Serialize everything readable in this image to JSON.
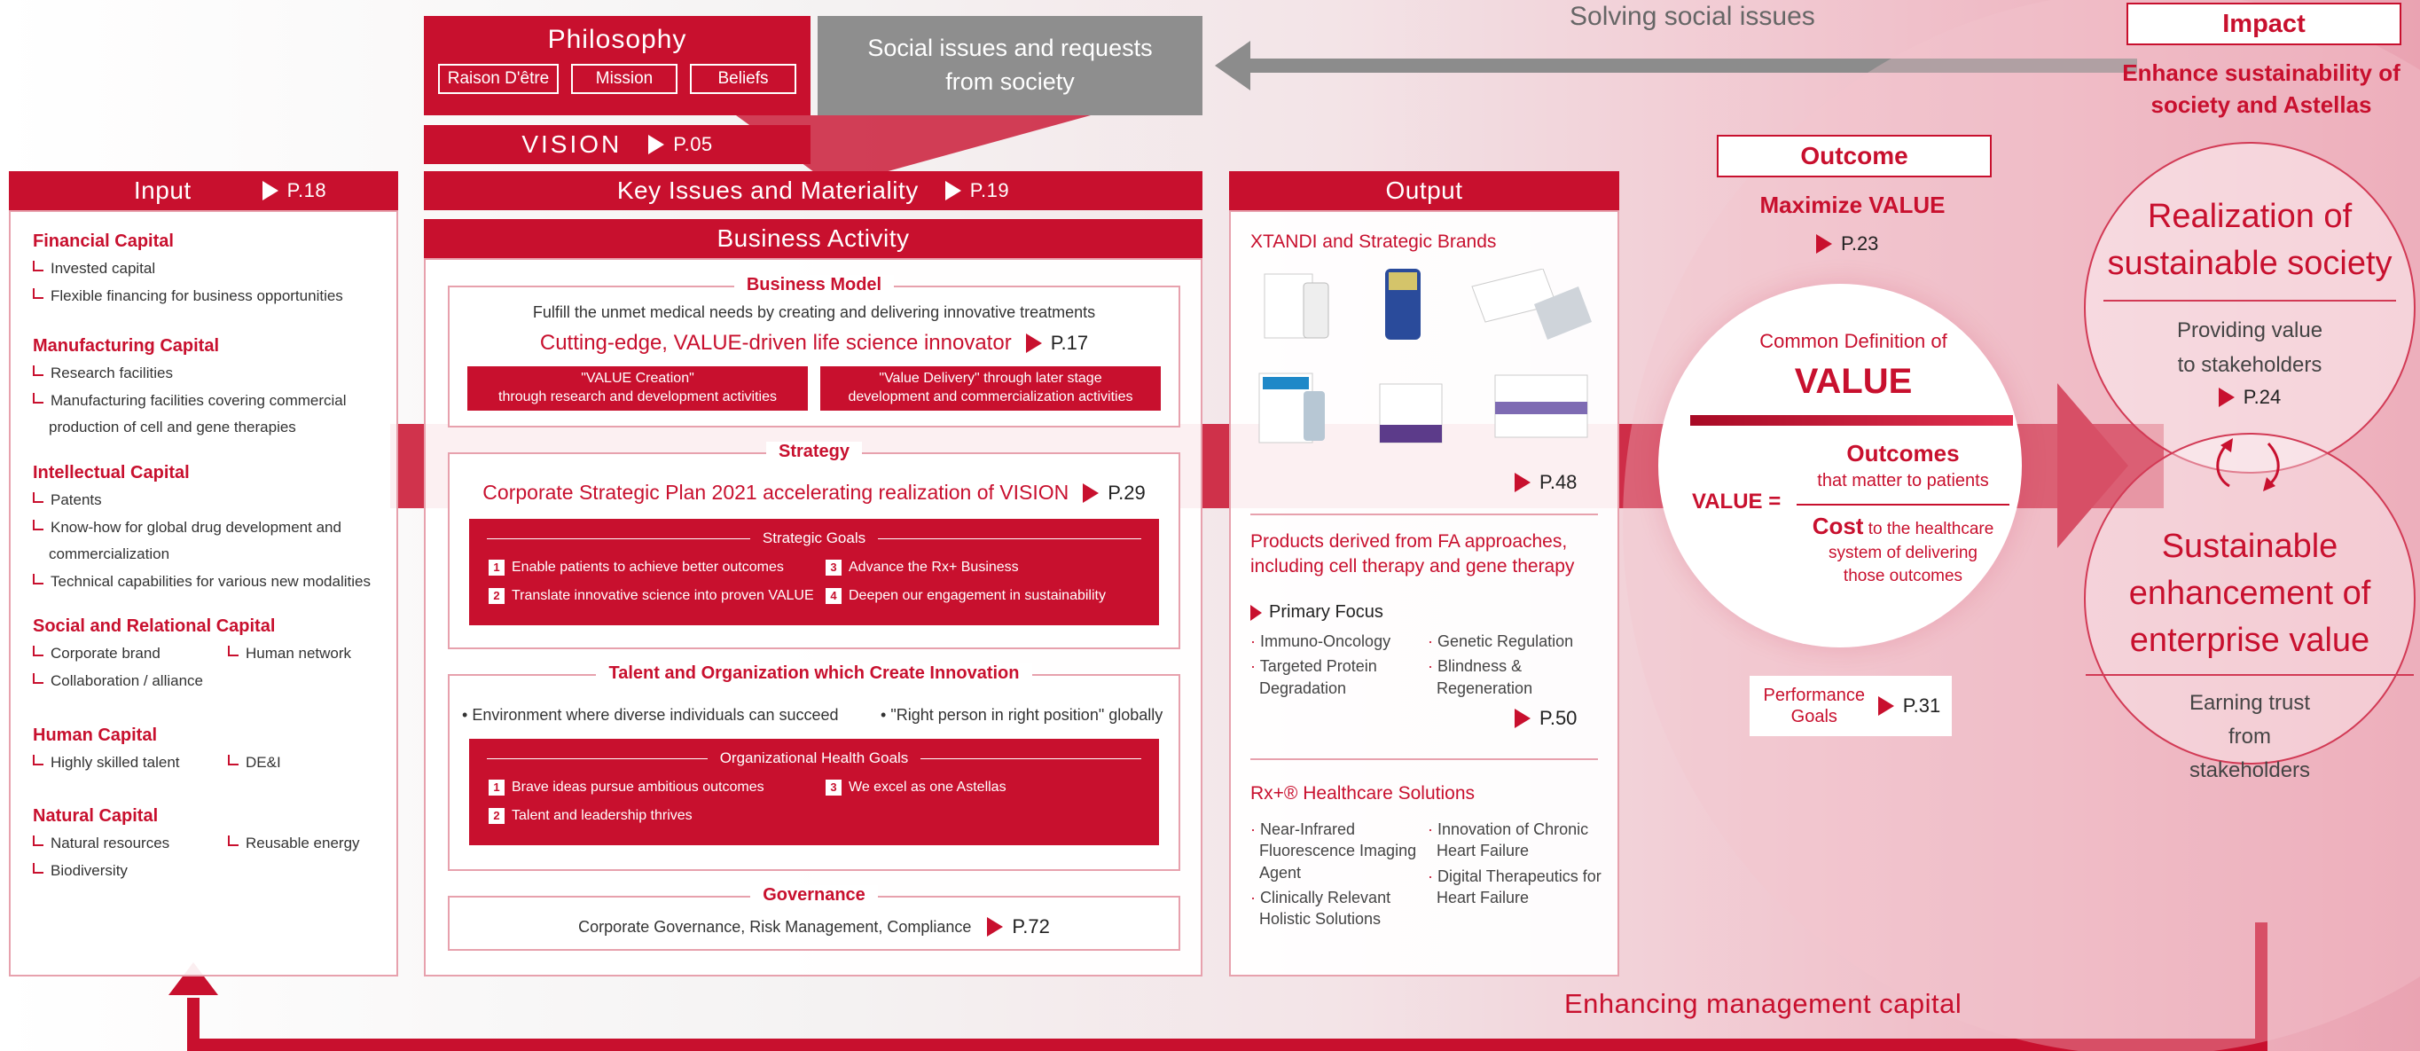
{
  "top": {
    "philosophy": "Philosophy",
    "philosophy_items": [
      "Raison D'être",
      "Mission",
      "Beliefs"
    ],
    "social_issues": "Social issues and requests from society",
    "solving": "Solving social issues",
    "vision": "VISION",
    "vision_ref": "P.05"
  },
  "impact": {
    "label": "Impact",
    "text": "Enhance sustainability of society and Astellas",
    "circle1_title": "Realization of sustainable society",
    "circle1_sub": "Providing value to stakeholders",
    "circle1_ref": "P.24",
    "circle2_title": "Sustainable enhancement of enterprise value",
    "circle2_sub": "Earning trust from stakeholders"
  },
  "input": {
    "title": "Input",
    "ref": "P.18",
    "groups": [
      {
        "title": "Financial Capital",
        "items": [
          "Invested capital",
          "Flexible financing for business opportunities"
        ]
      },
      {
        "title": "Manufacturing Capital",
        "items": [
          "Research facilities",
          "Manufacturing facilities covering commercial",
          "production of cell and gene therapies"
        ]
      },
      {
        "title": "Intellectual Capital",
        "items": [
          "Patents",
          "Know-how for global drug development and",
          "commercialization",
          "Technical capabilities for various new modalities"
        ]
      },
      {
        "title": "Social and Relational Capital",
        "items": [
          "Corporate brand",
          "Human network",
          "Collaboration / alliance"
        ]
      },
      {
        "title": "Human Capital",
        "items": [
          "Highly skilled talent",
          "DE&I"
        ]
      },
      {
        "title": "Natural Capital",
        "items": [
          "Natural resources",
          "Reusable energy",
          "Biodiversity"
        ]
      }
    ]
  },
  "center": {
    "key_issues": "Key Issues and Materiality",
    "key_ref": "P.19",
    "business_activity": "Business Activity",
    "bm_title": "Business Model",
    "bm_text": "Fulfill the unmet medical needs by creating and delivering innovative treatments",
    "bm_headline": "Cutting-edge, VALUE-driven life science innovator",
    "bm_ref": "P.17",
    "bm_left_a": "\"VALUE Creation\"",
    "bm_left_b": "through research and development activities",
    "bm_right_a": "\"Value Delivery\"",
    "bm_right_b": " through later stage",
    "bm_right_c": "development and commercialization activities",
    "strategy_title": "Strategy",
    "strategy_headline": "Corporate Strategic Plan 2021 accelerating realization of VISION",
    "strategy_ref": "P.29",
    "strategic_goals_title": "Strategic Goals",
    "strategic_goals": [
      {
        "n": "1",
        "t": "Enable patients to achieve better outcomes"
      },
      {
        "n": "3",
        "t": "Advance the Rx+ Business"
      },
      {
        "n": "2",
        "t": "Translate innovative science into proven VALUE"
      },
      {
        "n": "4",
        "t": "Deepen our engagement in sustainability"
      }
    ],
    "talent_title": "Talent and Organization which Create Innovation",
    "talent_a": "Environment where diverse individuals can succeed",
    "talent_b": "\"Right person in right position\" globally",
    "org_goals_title": "Organizational Health Goals",
    "org_goals": [
      {
        "n": "1",
        "t": "Brave ideas pursue ambitious outcomes"
      },
      {
        "n": "3",
        "t": "We excel as one Astellas"
      },
      {
        "n": "2",
        "t": "Talent and leadership thrives"
      }
    ],
    "gov_title": "Governance",
    "gov_text": "Corporate Governance, Risk Management, Compliance",
    "gov_ref": "P.72"
  },
  "output": {
    "title": "Output",
    "brands": "XTANDI and Strategic Brands",
    "brands_ref": "P.48",
    "fa_title": "Products derived from FA approaches, including cell therapy and gene therapy",
    "primary_focus": "Primary Focus",
    "focus_left": [
      "Immuno-Oncology",
      "Targeted Protein Degradation"
    ],
    "focus_right": [
      "Genetic Regulation",
      "Blindness & Regeneration"
    ],
    "focus_ref": "P.50",
    "rx_title": "Rx+® Healthcare Solutions",
    "rx_left": [
      "Near-Infrared Fluorescence Imaging Agent",
      "Clinically Relevant Holistic Solutions"
    ],
    "rx_right": [
      "Innovation of Chronic Heart Failure",
      "Digital Therapeutics for Heart Failure"
    ]
  },
  "outcome": {
    "label": "Outcome",
    "maximize": "Maximize VALUE",
    "maximize_ref": "P.23",
    "common_def": "Common Definition of",
    "value": "VALUE",
    "value_eq": "VALUE =",
    "outcomes": "Outcomes",
    "outcomes_sub": "that matter to patients",
    "cost": "Cost",
    "cost_sub1": " to the healthcare",
    "cost_sub2": "system of delivering",
    "cost_sub3": "those outcomes",
    "perf": "Performance Goals",
    "perf_ref": "P.31"
  },
  "bottom": {
    "enhancing": "Enhancing management capital"
  },
  "colors": {
    "accent": "#c8102e",
    "border": "#e7a1ad"
  }
}
